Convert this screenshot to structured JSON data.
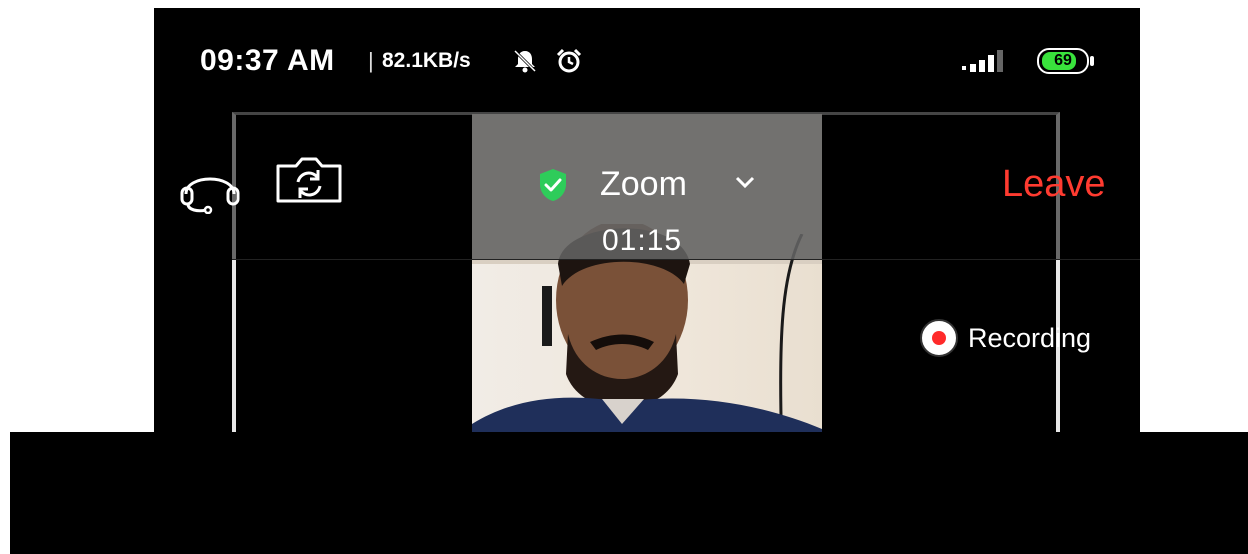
{
  "status_bar": {
    "time": "09:37 AM",
    "separator": "|",
    "network_speed": "82.1KB/s",
    "battery_level": "69",
    "icons": [
      "mute-icon",
      "alarm-icon",
      "signal-icon",
      "battery-icon"
    ]
  },
  "meeting": {
    "title": "Zoom",
    "timer": "01:15",
    "leave_label": "Leave",
    "recording_label": "Recording",
    "icons": [
      "audio-icon",
      "switch-camera-icon",
      "shield-icon",
      "chevron-down-icon",
      "record-dot-icon"
    ]
  },
  "colors": {
    "background": "#000000",
    "leave": "#ff3b30",
    "shield": "#2ecc5a",
    "battery": "#39e23c",
    "recording_dot": "#ff2a2a"
  }
}
